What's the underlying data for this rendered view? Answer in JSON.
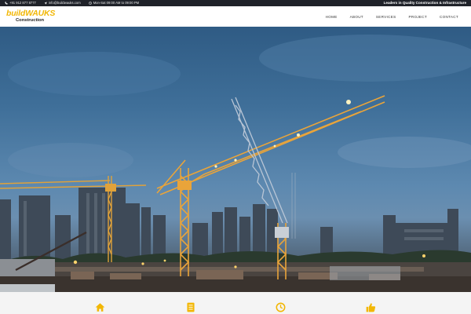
{
  "topbar": {
    "phone": "+91 912 877 8777",
    "email": "info@buildwauks.com",
    "hours": "Mon-Sat 09:00 AM to 09:00 PM",
    "tagline": "Leaders in Quality Construction & Infrastructure"
  },
  "logo": {
    "brand": "buildWAUKS",
    "sub": "Construction"
  },
  "nav": {
    "items": [
      "HOME",
      "ABOUT",
      "SERVICES",
      "PROJECT",
      "CONTACT"
    ]
  },
  "features": {
    "icons": [
      "home-icon",
      "document-icon",
      "clock-icon",
      "thumbs-up-icon"
    ],
    "accent": "#f2b705"
  },
  "colors": {
    "accent": "#f2b705",
    "topbar_bg": "#1f2229"
  }
}
